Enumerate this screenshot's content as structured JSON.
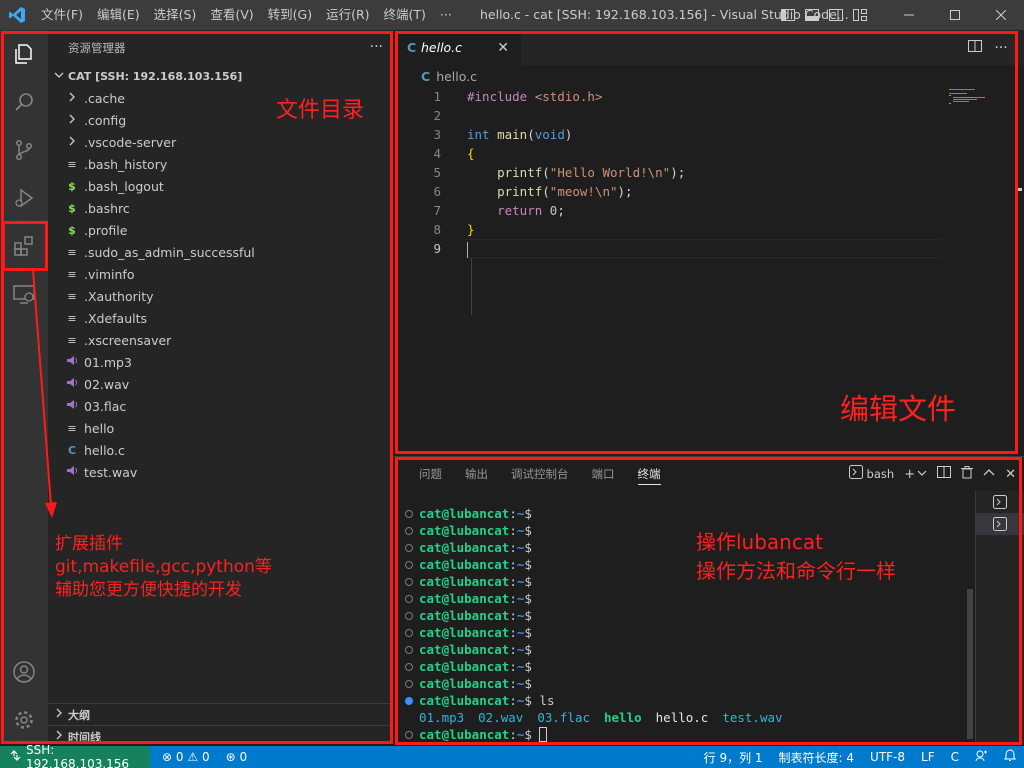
{
  "app": {
    "window_title": "hello.c - cat [SSH: 192.168.103.156] - Visual Studio Code...",
    "menu": [
      "文件(F)",
      "编辑(E)",
      "选择(S)",
      "查看(V)",
      "转到(G)",
      "运行(R)",
      "终端(T)",
      "···"
    ],
    "accent": "#007acc"
  },
  "sidebar": {
    "title": "资源管理器",
    "more": "···",
    "section": "CAT [SSH: 192.168.103.156]",
    "items": [
      {
        "label": ".cache",
        "icon": "chevron-right-icon"
      },
      {
        "label": ".config",
        "icon": "chevron-right-icon"
      },
      {
        "label": ".vscode-server",
        "icon": "chevron-right-icon"
      },
      {
        "label": ".bash_history",
        "icon": "text-file-icon"
      },
      {
        "label": ".bash_logout",
        "icon": "shell-file-icon"
      },
      {
        "label": ".bashrc",
        "icon": "shell-file-icon"
      },
      {
        "label": ".profile",
        "icon": "shell-file-icon"
      },
      {
        "label": ".sudo_as_admin_successful",
        "icon": "text-file-icon"
      },
      {
        "label": ".viminfo",
        "icon": "text-file-icon"
      },
      {
        "label": ".Xauthority",
        "icon": "text-file-icon"
      },
      {
        "label": ".Xdefaults",
        "icon": "text-file-icon"
      },
      {
        "label": ".xscreensaver",
        "icon": "text-file-icon"
      },
      {
        "label": "01.mp3",
        "icon": "audio-file-icon"
      },
      {
        "label": "02.wav",
        "icon": "audio-file-icon"
      },
      {
        "label": "03.flac",
        "icon": "audio-file-icon"
      },
      {
        "label": "hello",
        "icon": "text-file-icon"
      },
      {
        "label": "hello.c",
        "icon": "c-file-icon"
      },
      {
        "label": "test.wav",
        "icon": "audio-file-icon"
      }
    ],
    "outline": "大纲",
    "timeline": "时间线"
  },
  "editor": {
    "tab_label": "hello.c",
    "breadcrumb": "hello.c",
    "lines": [
      {
        "n": "1",
        "tokens": [
          {
            "t": "#include ",
            "c": "k-pre"
          },
          {
            "t": "<stdio.h>",
            "c": "k-inc"
          }
        ]
      },
      {
        "n": "2",
        "tokens": []
      },
      {
        "n": "3",
        "tokens": [
          {
            "t": "int ",
            "c": "k-type"
          },
          {
            "t": "main",
            "c": "k-fn"
          },
          {
            "t": "(",
            "c": "k-def"
          },
          {
            "t": "void",
            "c": "k-type"
          },
          {
            "t": ")",
            "c": "k-def"
          }
        ]
      },
      {
        "n": "4",
        "tokens": [
          {
            "t": "{",
            "c": "k-br"
          }
        ]
      },
      {
        "n": "5",
        "tokens": [
          {
            "t": "    ",
            "c": "k-def"
          },
          {
            "t": "printf",
            "c": "k-fn"
          },
          {
            "t": "(",
            "c": "k-def"
          },
          {
            "t": "\"Hello World!\\n\"",
            "c": "k-str"
          },
          {
            "t": ");",
            "c": "k-def"
          }
        ]
      },
      {
        "n": "6",
        "tokens": [
          {
            "t": "    ",
            "c": "k-def"
          },
          {
            "t": "printf",
            "c": "k-fn"
          },
          {
            "t": "(",
            "c": "k-def"
          },
          {
            "t": "\"meow!\\n\"",
            "c": "k-str"
          },
          {
            "t": ");",
            "c": "k-def"
          }
        ]
      },
      {
        "n": "7",
        "tokens": [
          {
            "t": "    ",
            "c": "k-def"
          },
          {
            "t": "return ",
            "c": "k-ret"
          },
          {
            "t": "0",
            "c": "k-num"
          },
          {
            "t": ";",
            "c": "k-def"
          }
        ]
      },
      {
        "n": "8",
        "tokens": [
          {
            "t": "}",
            "c": "k-br"
          }
        ]
      },
      {
        "n": "9",
        "tokens": []
      }
    ]
  },
  "panel": {
    "tabs": [
      "问题",
      "输出",
      "调试控制台",
      "端口",
      "终端"
    ],
    "active_tab": "终端",
    "shell": "bash",
    "prompt_user": "cat@lubancat",
    "prompt_sep": ":",
    "prompt_tilde": "~",
    "prompt_end": "$",
    "command": " ls",
    "ls_output": [
      {
        "name": "01.mp3",
        "c": "c-cyan"
      },
      {
        "name": "02.wav",
        "c": "c-cyan"
      },
      {
        "name": "03.flac",
        "c": "c-cyan"
      },
      {
        "name": "hello",
        "c": "c-green"
      },
      {
        "name": "hello.c",
        "c": "c-white"
      },
      {
        "name": "test.wav",
        "c": "c-cyan"
      }
    ],
    "empty_prompts": 11
  },
  "statusbar": {
    "remote": "SSH: 192.168.103.156",
    "errors": "0",
    "warnings": "0",
    "ports": "0",
    "position": "行 9，列 1",
    "tab_size": "制表符长度: 4",
    "encoding": "UTF-8",
    "eol": "LF",
    "language": "C"
  },
  "annotations": {
    "file_dir": "文件目录",
    "edit_file": "编辑文件",
    "extensions_line1": "扩展插件",
    "extensions_line2": "git,makefile,gcc,python等",
    "extensions_line3": "辅助您更方便快捷的开发",
    "terminal_line1": "操作lubancat",
    "terminal_line2": "操作方法和命令行一样"
  }
}
